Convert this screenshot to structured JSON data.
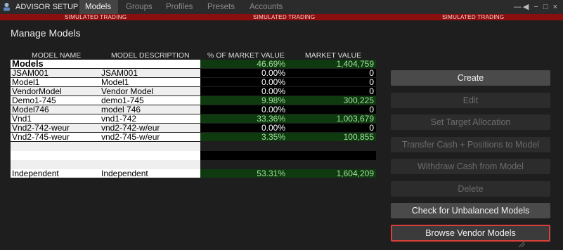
{
  "topbar": {
    "title": "ADVISOR SETUP",
    "tabs": [
      {
        "label": "Models",
        "active": true
      },
      {
        "label": "Groups",
        "active": false
      },
      {
        "label": "Profiles",
        "active": false
      },
      {
        "label": "Presets",
        "active": false
      },
      {
        "label": "Accounts",
        "active": false
      }
    ],
    "window_controls": "—◀ − □ ×"
  },
  "sim_banner": {
    "text": "SIMULATED TRADING"
  },
  "page_title": "Manage Models",
  "table": {
    "headers": [
      "MODEL NAME",
      "MODEL DESCRIPTION",
      "% OF MARKET VALUE",
      "MARKET VALUE"
    ],
    "rows": [
      {
        "name": "Models",
        "desc": "",
        "pct": "46.69%",
        "mv": "1,404,759"
      },
      {
        "name": "JSAM001",
        "desc": "JSAM001",
        "pct": "0.00%",
        "mv": "0"
      },
      {
        "name": "Model1",
        "desc": "Model1",
        "pct": "0.00%",
        "mv": "0"
      },
      {
        "name": "VendorModel",
        "desc": "Vendor Model",
        "pct": "0.00%",
        "mv": "0"
      },
      {
        "name": "Demo1-745",
        "desc": "demo1-745",
        "pct": "9.98%",
        "mv": "300,225"
      },
      {
        "name": "Model746",
        "desc": "model 746",
        "pct": "0.00%",
        "mv": "0"
      },
      {
        "name": "Vnd1",
        "desc": "vnd1-742",
        "pct": "33.36%",
        "mv": "1,003,679"
      },
      {
        "name": "Vnd2-742-weur",
        "desc": "vnd2-742-w/eur",
        "pct": "0.00%",
        "mv": "0"
      },
      {
        "name": "Vnd2-745-weur",
        "desc": "vnd2-745-w/eur",
        "pct": "3.35%",
        "mv": "100,855"
      },
      {
        "name": "",
        "desc": "",
        "pct": "",
        "mv": ""
      },
      {
        "name": "",
        "desc": "",
        "pct": "",
        "mv": ""
      },
      {
        "name": "",
        "desc": "",
        "pct": "",
        "mv": ""
      },
      {
        "name": "Independent",
        "desc": "Independent",
        "pct": "53.31%",
        "mv": "1,604,209"
      }
    ]
  },
  "buttons": {
    "create": "Create",
    "edit": "Edit",
    "set_target": "Set Target Allocation",
    "transfer": "Transfer Cash + Positions to Model",
    "withdraw": "Withdraw Cash from Model",
    "delete": "Delete",
    "check_unbalanced": "Check for Unbalanced Models",
    "browse_vendor": "Browse Vendor Models"
  },
  "colors": {
    "positive_bg": "#0f3a10",
    "positive_text": "#9fe39a",
    "sim_banner": "#8a0f0f",
    "selected_border": "#d9403a"
  }
}
